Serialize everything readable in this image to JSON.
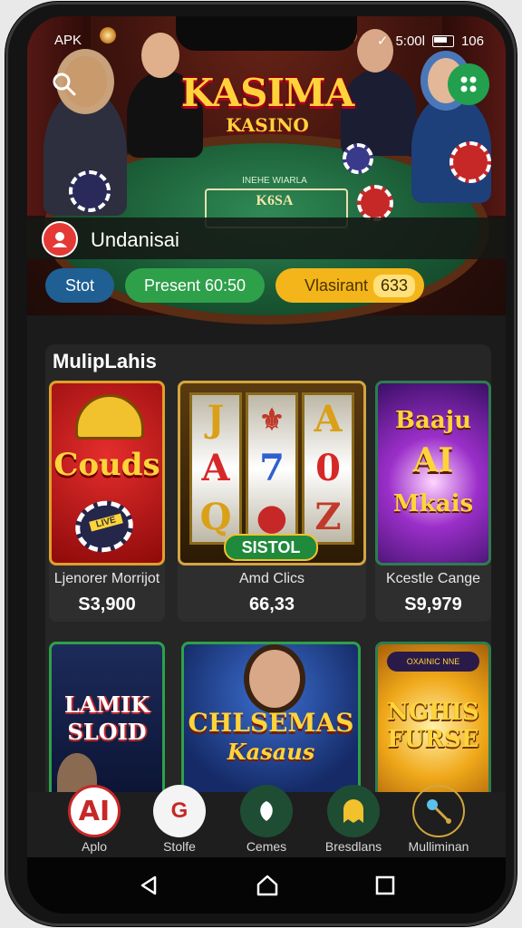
{
  "status_bar": {
    "left_text": "APK",
    "right_text": "5:00l",
    "battery_text": "106"
  },
  "hero": {
    "title": "KASIMA",
    "subtitle": "KASINO",
    "table_text": "INEHE WIARLA",
    "table_box_text": "K6SA",
    "search_icon": "search-icon",
    "menu_icon": "grid-menu-icon",
    "accent_color": "#22a04d"
  },
  "user": {
    "name": "Undanisai"
  },
  "pills": [
    {
      "label": "Stot"
    },
    {
      "label": "Present 60:50"
    },
    {
      "label": "Vlasirant",
      "value": "633"
    }
  ],
  "section": {
    "title": "MulipLahis",
    "cards": [
      {
        "name": "Ljenorer Morrijot",
        "value": "S3,900",
        "art_text": "Couds",
        "badge": "LIVE"
      },
      {
        "name": "Amd Clics",
        "value": "66,33",
        "art_text": "SISTOL",
        "reel_symbols": [
          "J",
          "A",
          "Q",
          "⚜",
          "7",
          "●",
          "A",
          "0",
          "Z"
        ]
      },
      {
        "name": "Kcestle Cange",
        "value": "S9,979",
        "art_text_1": "Baaju",
        "art_text_2": "AI",
        "art_text_3": "Mkais"
      },
      {
        "name": "",
        "value": "",
        "art_text_1": "LAMIK",
        "art_text_2": "SLOID"
      },
      {
        "name": "",
        "value": "",
        "art_text_1": "CHLSEMAS",
        "art_text_2": "Kasaus"
      },
      {
        "name": "",
        "value": "",
        "art_text_1": "NGHIS",
        "art_text_2": "FURSE",
        "banner": "OXAINIC NNE"
      }
    ]
  },
  "bottom_nav": [
    {
      "label": "Aplo"
    },
    {
      "label": "Stolfe"
    },
    {
      "label": "Cemes"
    },
    {
      "label": "Bresdlans"
    },
    {
      "label": "Mulliminan"
    }
  ]
}
